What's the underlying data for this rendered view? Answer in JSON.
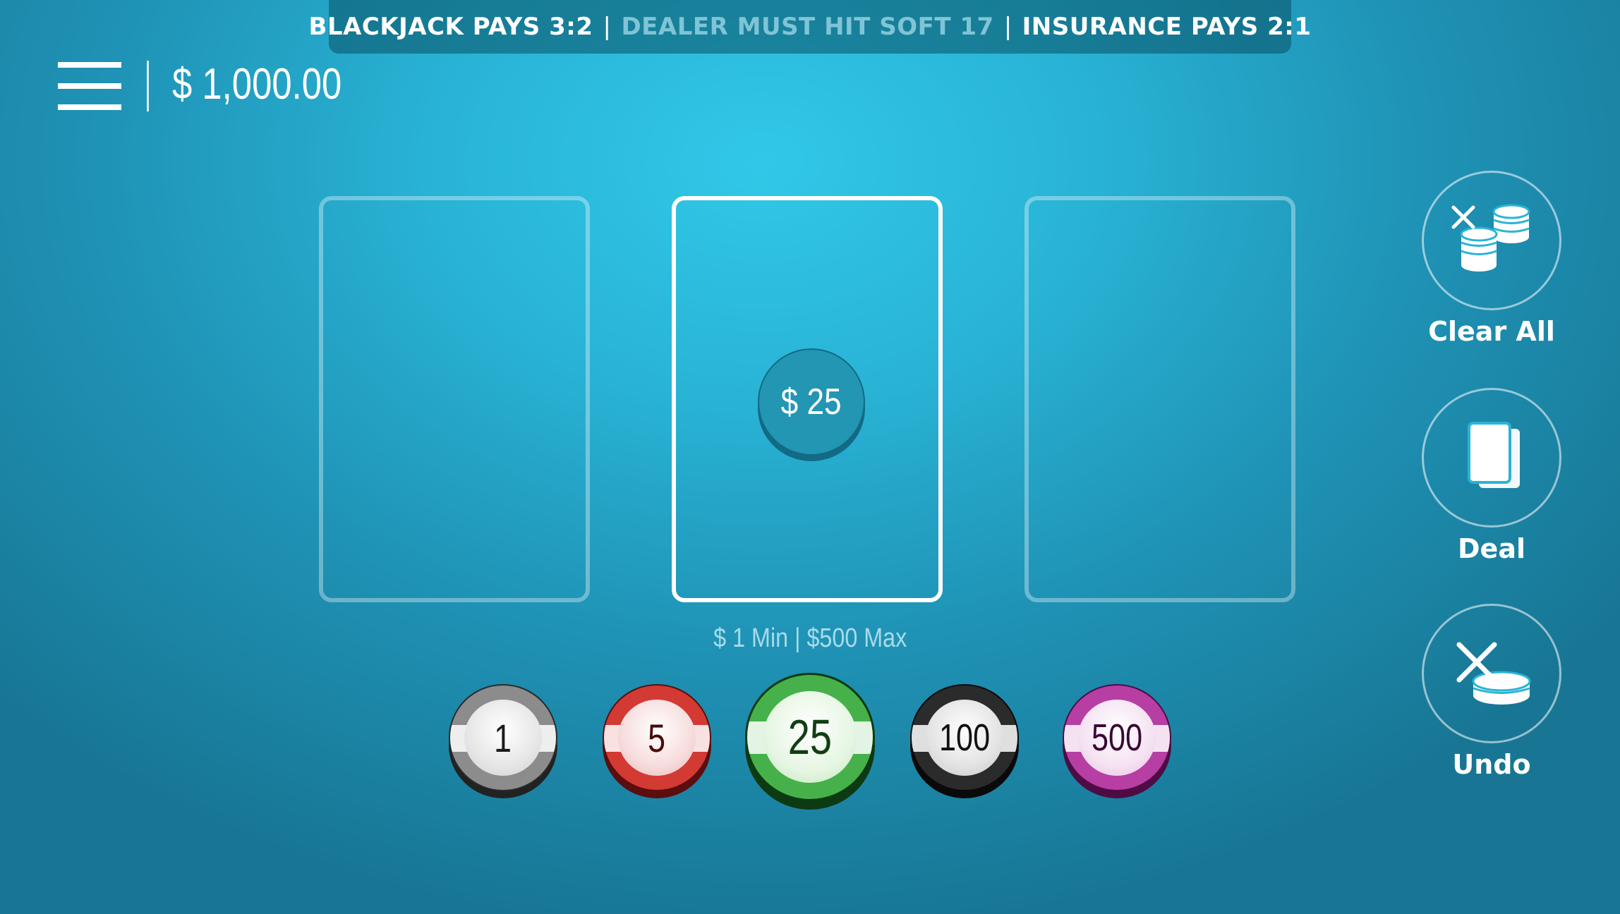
{
  "rules": {
    "blackjack": "BLACKJACK PAYS 3:2",
    "dealer": "DEALER MUST HIT SOFT 17",
    "insurance": "INSURANCE PAYS 2:1",
    "separator": "|"
  },
  "header": {
    "balance": "$ 1,000.00",
    "menu_icon": "hamburger-menu-icon"
  },
  "table": {
    "spots": [
      {
        "active": false
      },
      {
        "active": true,
        "bet_label": "$ 25"
      },
      {
        "active": false
      }
    ],
    "limits": "$ 1 Min | $500 Max"
  },
  "chips": [
    {
      "value": "1",
      "color": "#d7d7d7",
      "accent": "#8c8c8c"
    },
    {
      "value": "5",
      "color": "#f1c7c7",
      "accent": "#c9302c"
    },
    {
      "value": "25",
      "color": "#dff3dc",
      "accent": "#3fae44",
      "selected": true
    },
    {
      "value": "100",
      "color": "#d9d9d9",
      "accent": "#2b2b2b"
    },
    {
      "value": "500",
      "color": "#f1dcee",
      "accent": "#b13a9e"
    }
  ],
  "actions": {
    "clear_all": "Clear All",
    "deal": "Deal",
    "undo": "Undo"
  },
  "colors": {
    "felt": "#29b4d6",
    "bet_chip": "#2296b3"
  }
}
